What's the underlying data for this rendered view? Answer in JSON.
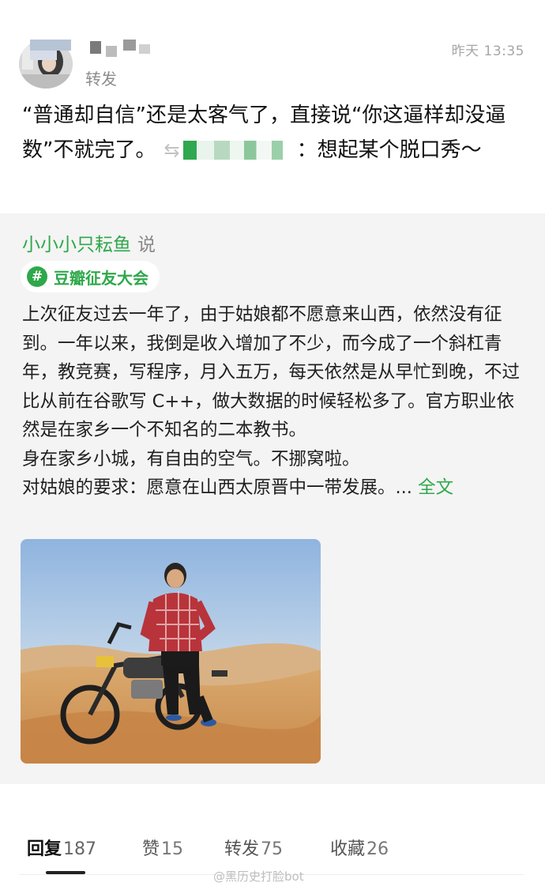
{
  "header": {
    "action": "转发",
    "timestamp": "昨天 13:35"
  },
  "repost": {
    "text": "“普通却自信”还是太客气了，直接说“你这逼样却没逼数”不就完了。",
    "icon": "repost-icon",
    "quote_suffix": "：想起某个脱口秀～"
  },
  "quoted": {
    "author": "小小小只耘鱼",
    "said": "说",
    "topic": "豆瓣征友大会",
    "body_lines": [
      "上次征友过去一年了，由于姑娘都不愿意来山西，依然没有征到。一年以来，我倒是收入增加了不少，而今成了一个斜杠青年，教竞赛，写程序，月入五万，每天依然是从早忙到晚，不过比从前在谷歌写 C++，做大数据的时候轻松多了。官方职业依然是在家乡一个不知名的二本教书。",
      "身在家乡小城，有自由的空气。不挪窝啦。",
      "对姑娘的要求：愿意在山西太原晋中一带发展。... "
    ],
    "more": "全文"
  },
  "actions": [
    {
      "label": "回复",
      "count": "187"
    },
    {
      "label": "赞",
      "count": "15"
    },
    {
      "label": "转发",
      "count": "75"
    },
    {
      "label": "收藏",
      "count": "26"
    }
  ],
  "watermark": "@黑历史打脸bot",
  "colors": {
    "accent_green": "#2ea84a",
    "card_bg": "#f4f4f4"
  }
}
